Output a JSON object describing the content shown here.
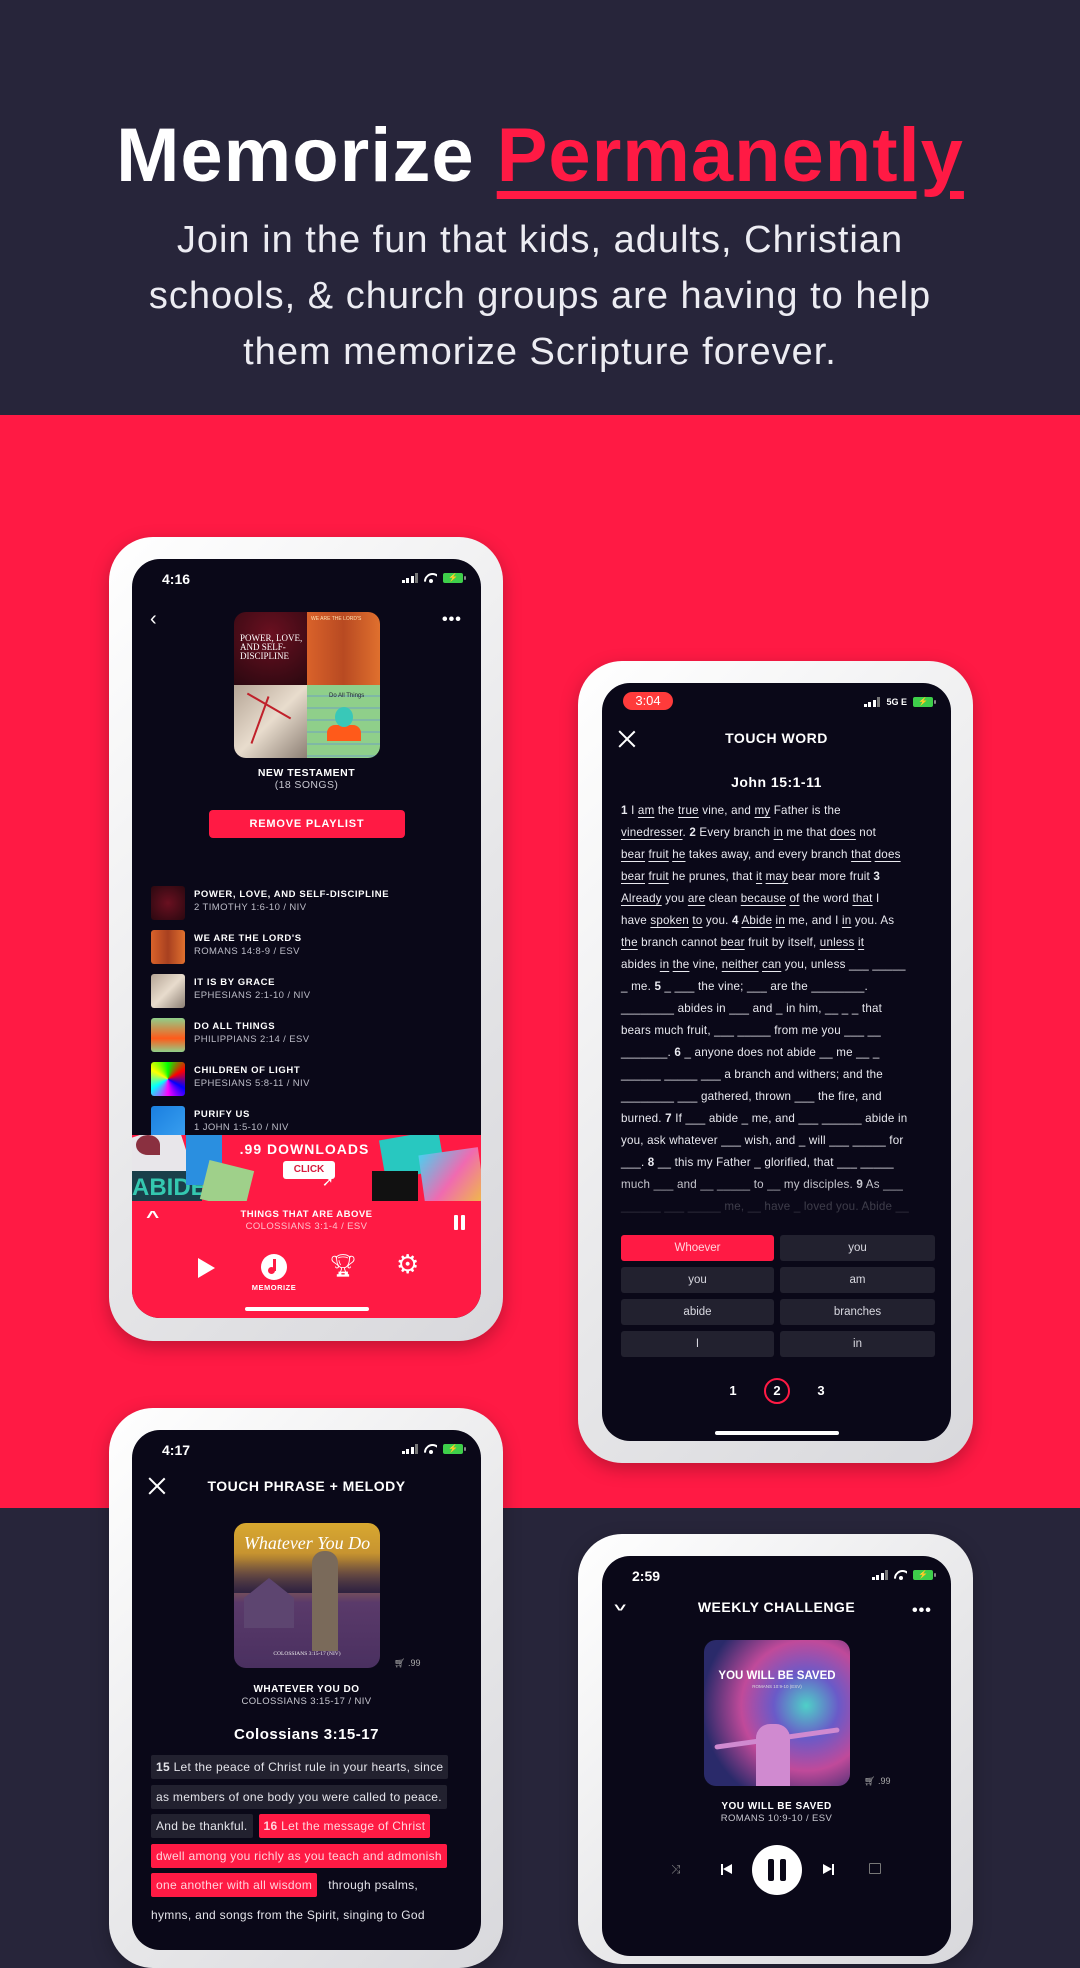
{
  "colors": {
    "accent": "#ff1a44",
    "dark_band": "#27253a",
    "screen_bg": "#0a0818",
    "battery": "#3ecf4a"
  },
  "hero": {
    "title_main": "Memorize",
    "title_accent": "Permanently",
    "subtitle_lines": [
      "Join in the fun that kids, adults, Christian",
      "schools, & church groups are having to help",
      "them memorize Scripture forever."
    ]
  },
  "phone_playlist": {
    "time": "4:16",
    "icons": {
      "back": "chevron-left-icon",
      "more": "more-dots-icon"
    },
    "more_label": "•••",
    "playlist_title": "NEW TESTAMENT",
    "playlist_count": "(18 SONGS)",
    "remove_button": "REMOVE PLAYLIST",
    "art_text": {
      "tile1": "POWER, LOVE, AND SELF-DISCIPLINE",
      "tile2": "WE ARE THE LORD'S",
      "tile4": "Do All Things"
    },
    "songs": [
      {
        "title": "POWER, LOVE, AND SELF-DISCIPLINE",
        "ref": "2 TIMOTHY 1:6-10 / NIV"
      },
      {
        "title": "WE ARE THE LORD'S",
        "ref": "ROMANS 14:8-9 / ESV"
      },
      {
        "title": "IT IS BY GRACE",
        "ref": "EPHESIANS 2:1-10 / NIV"
      },
      {
        "title": "DO ALL THINGS",
        "ref": "PHILIPPIANS 2:14 / ESV"
      },
      {
        "title": "CHILDREN OF LIGHT",
        "ref": "EPHESIANS 5:8-11 / NIV"
      },
      {
        "title": "PURIFY US",
        "ref": "1 JOHN 1:5-10 / NIV"
      }
    ],
    "banner": {
      "headline": ".99 DOWNLOADS",
      "cta": "CLICK",
      "collage_text": "ABIDE"
    },
    "now_playing": {
      "title": "THINGS THAT ARE ABOVE",
      "ref": "COLOSSIANS 3:1-4 / ESV"
    },
    "nav": {
      "play": "play-icon",
      "memorize": "MEMORIZE",
      "trophy": "trophy-icon",
      "settings": "gear-icon"
    }
  },
  "phone_touch_word": {
    "time": "3:04",
    "network": "5G E",
    "title": "TOUCH WORD",
    "passage": "John 15:1-11",
    "lines": [
      "{1} I [am] the [true] vine, and [my] Father is the",
      "[vinedresser]. {2} Every branch [in] me that [does] not",
      "[bear] [fruit] [he] takes away, and every branch [that] [does]",
      "[bear] [fruit] he prunes, that [it] [may] bear more fruit {3}",
      "[Already] you [are] clean [because] [of] the word [that] I",
      "have [spoken] [to] you. {4} [Abide] [in] me, and I [in] you. As",
      "[the] branch cannot [bear] fruit by itself, [unless] [it]",
      "abides [in] [the] vine, [neither] [can] you, unless ___ _____",
      "_ me. {5} _ ___ the vine; ___ are the ________.",
      "________ abides in ___ and _ in him, __ _ _ that",
      "bears much fruit, ___ _____ from me you ___ __",
      "_______. {6} _ anyone does not abide __ me __ _",
      "______ _____ ___ a branch and withers; and the",
      "________ ___ gathered, thrown ___ the fire, and",
      "burned. {7} If ___ abide _ me, and ___ ______ abide in",
      "you, ask whatever ___ wish, and _ will ___ _____ for",
      "___. {8} __ this my Father _ glorified, that ___ _____",
      "much ___ and __ _____ to __ my disciples. {9} As ___",
      "______ ___ _____ me, __ have _ loved you. Abide __"
    ],
    "choices": [
      "Whoever",
      "you",
      "you",
      "am",
      "abide",
      "branches",
      "I",
      "in"
    ],
    "selected_choice": 0,
    "pages": [
      "1",
      "2",
      "3"
    ],
    "current_page": "2"
  },
  "phone_phrase": {
    "time": "4:17",
    "title": "TOUCH PHRASE + MELODY",
    "art_title": "Whatever You Do",
    "art_caption": "COLOSSIANS 3:15-17 (NIV)",
    "price": ".99",
    "song_title": "WHATEVER YOU DO",
    "song_ref": "COLOSSIANS 3:15-17 / NIV",
    "passage": "Colossians 3:15-17",
    "lines": [
      [
        {
          "num": "15",
          "text": " Let the peace of Christ rule in your hearts, since",
          "style": "dark"
        }
      ],
      [
        {
          "text": "as members of one body you were called to peace.",
          "style": "dark"
        }
      ],
      [
        {
          "text": "And be thankful.",
          "style": "dark"
        },
        {
          "num": "16",
          "text": " Let the message of Christ",
          "style": "red"
        }
      ],
      [
        {
          "text": "dwell among you richly as you teach and admonish",
          "style": "red"
        }
      ],
      [
        {
          "text": "one another with all wisdom",
          "style": "red"
        },
        {
          "text": "through psalms,",
          "style": "plain"
        }
      ],
      [
        {
          "text": "hymns, and songs from the Spirit, singing to God",
          "style": "plain"
        }
      ]
    ]
  },
  "phone_weekly": {
    "time": "2:59",
    "title": "WEEKLY CHALLENGE",
    "more_label": "•••",
    "art_title": "YOU WILL BE SAVED",
    "art_caption": "ROMANS 10:9-10 (ESV)",
    "price": ".99",
    "song_title": "YOU WILL BE SAVED",
    "song_ref": "ROMANS 10:9-10 / ESV",
    "controls": [
      "shuffle-icon",
      "previous-icon",
      "pause-icon",
      "next-icon",
      "repeat-icon"
    ]
  }
}
